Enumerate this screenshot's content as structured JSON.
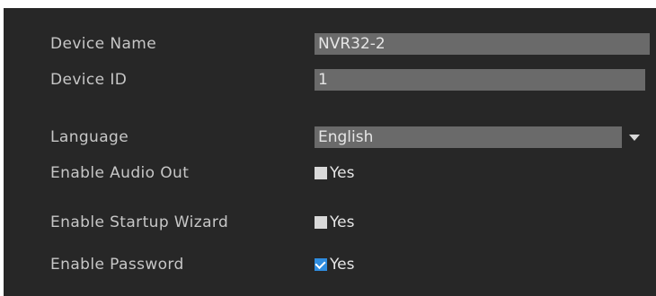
{
  "settings": {
    "device_name": {
      "label": "Device Name",
      "value": "NVR32-2"
    },
    "device_id": {
      "label": "Device ID",
      "value": "1"
    },
    "language": {
      "label": "Language",
      "selected": "English",
      "icon": "chevron-down-icon"
    },
    "audio_out": {
      "label": "Enable Audio Out",
      "option": "Yes",
      "checked": false
    },
    "startup_wizard": {
      "label": "Enable Startup Wizard",
      "option": "Yes",
      "checked": false
    },
    "password": {
      "label": "Enable Password",
      "option": "Yes",
      "checked": true
    }
  },
  "colors": {
    "panel_bg": "#272727",
    "field_bg": "#6a6a6a",
    "label_text": "#c7c7c7",
    "checkbox_checked": "#2f8de0",
    "checkbox_unchecked": "#d9d9d9"
  }
}
